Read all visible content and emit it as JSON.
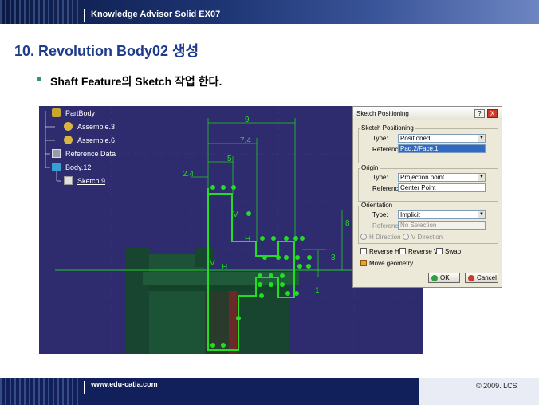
{
  "header": {
    "course_title": "Knowledge Advisor Solid EX07"
  },
  "slide": {
    "title": "10. Revolution Body02 생성",
    "bullet": "Shaft Feature의 Sketch 작업 한다."
  },
  "tree": {
    "items": [
      {
        "label": "PartBody",
        "icon": "partbody-icon"
      },
      {
        "label": "Assemble.3",
        "icon": "assemble-icon"
      },
      {
        "label": "Assemble.6",
        "icon": "assemble-icon"
      },
      {
        "label": "Reference Data",
        "icon": "reference-icon"
      },
      {
        "label": "Body.12",
        "icon": "body-icon"
      },
      {
        "label": "Sketch.9",
        "icon": "sketch-icon"
      }
    ]
  },
  "sketch": {
    "dimensions": [
      "9",
      "7.4",
      "5",
      "2.4",
      "8",
      "3",
      "1"
    ],
    "constraint_labels": [
      "V",
      "H"
    ]
  },
  "dialog": {
    "title": "Sketch Positioning",
    "help_button": "?",
    "close_button": "X",
    "sketch_positioning": {
      "group_label": "Sketch Positioning",
      "type_label": "Type:",
      "type_value": "Positioned",
      "reference_label": "Reference:",
      "reference_value": "Pad.2/Face.1"
    },
    "origin": {
      "group_label": "Origin",
      "type_label": "Type:",
      "type_value": "Projection point",
      "reference_label": "Reference:",
      "reference_value": "Center Point"
    },
    "orientation": {
      "group_label": "Orientation",
      "type_label": "Type:",
      "type_value": "Implicit",
      "reference_label": "Reference:",
      "reference_value": "No Selection",
      "h_direction": "H Direction",
      "v_direction": "V Direction",
      "reverse_h": "Reverse H",
      "reverse_v": "Reverse V",
      "swap": "Swap"
    },
    "move_geometry": "Move geometry",
    "ok": "OK",
    "cancel": "Cancel"
  },
  "footer": {
    "url": "www.edu-catia.com",
    "copyright": "© 2009. LCS"
  },
  "colors": {
    "title_blue": "#1f3c8c",
    "viewport_bg": "#2e2b6e",
    "sketch_green": "#22cc22",
    "part_green": "#17452f"
  }
}
